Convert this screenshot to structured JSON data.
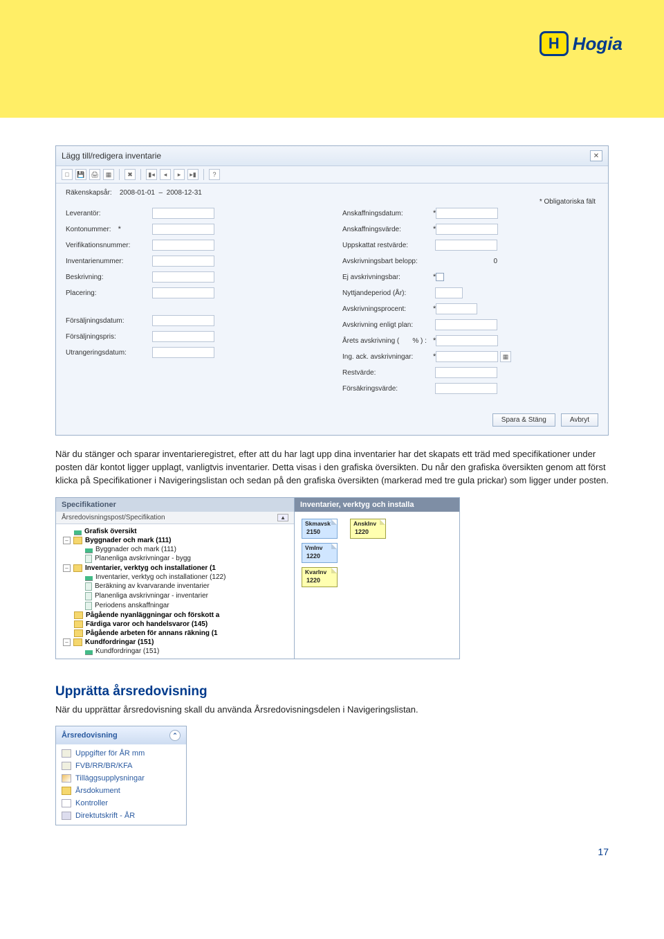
{
  "logo": {
    "badge": "H",
    "text": "Hogia"
  },
  "window": {
    "title": "Lägg till/redigera inventarie",
    "rakenskapsar_label": "Räkenskapsår:",
    "rakenskapsar_from": "2008-01-01",
    "rakenskapsar_sep": "–",
    "rakenskapsar_to": "2008-12-31",
    "mandatory_note": "* Obligatoriska fält",
    "left_fields": {
      "leverantor": "Leverantör:",
      "kontonummer": "Kontonummer:",
      "verifikationsnummer": "Verifikationsnummer:",
      "inventarienummer": "Inventarienummer:",
      "beskrivning": "Beskrivning:",
      "placering": "Placering:",
      "forsaljningsdatum": "Försäljningsdatum:",
      "forsaljningspris": "Försäljningspris:",
      "utrangeringsdatum": "Utrangeringsdatum:"
    },
    "right_fields": {
      "anskaffningsdatum": "Anskaffningsdatum:",
      "anskaffningsvarde": "Anskaffningsvärde:",
      "uppskattat_restvarde": "Uppskattat restvärde:",
      "avskrivningsbart_belopp": "Avskrivningsbart belopp:",
      "avskrivningsbart_value": "0",
      "ej_avskrivningsbar": "Ej avskrivningsbar:",
      "nyttjandeperiod": "Nyttjandeperiod (År):",
      "avskrivningsprocent": "Avskrivningsprocent:",
      "avskrivning_plan": "Avskrivning enligt plan:",
      "arets_avskrivning": "Årets avskrivning (",
      "arets_avskrivning_suffix": "% ) :",
      "ing_ack": "Ing. ack. avskrivningar:",
      "restvarde": "Restvärde:",
      "forsakringsvarde": "Försäkringsvärde:"
    },
    "buttons": {
      "save": "Spara & Stäng",
      "cancel": "Avbryt"
    }
  },
  "paragraph1": "När du stänger och sparar inventarieregistret, efter att du har lagt upp dina inventarier har det skapats ett träd med specifikationer under posten där kontot ligger upplagt, vanligtvis inventarier. Detta visas i den grafiska översikten. Du når den grafiska översikten genom att först klicka på Specifikationer i Navigeringslistan och sedan på den grafiska översikten (markerad med tre gula prickar) som ligger under posten.",
  "spec_panel": {
    "left_title": "Specifikationer",
    "right_title": "Inventarier, verktyg och installa",
    "subheader": "Årsredovisningspost/Specifikation",
    "tree": [
      {
        "indent": 1,
        "icon": "bar",
        "label": "Grafisk översikt",
        "bold": true
      },
      {
        "indent": 0,
        "icon": "exp-",
        "folder": true,
        "label": "Byggnader och mark (111)",
        "bold": true
      },
      {
        "indent": 2,
        "icon": "bar",
        "label": "Byggnader och mark (111)"
      },
      {
        "indent": 2,
        "icon": "page",
        "label": "Planenliga avskrivningar - bygg"
      },
      {
        "indent": 0,
        "icon": "exp-",
        "folder": true,
        "label": "Inventarier, verktyg och installationer (1",
        "bold": true
      },
      {
        "indent": 2,
        "icon": "bar",
        "label": "Inventarier, verktyg och installationer (122)"
      },
      {
        "indent": 2,
        "icon": "page",
        "label": "Beräkning av kvarvarande inventarier"
      },
      {
        "indent": 2,
        "icon": "page",
        "label": "Planenliga avskrivningar - inventarier"
      },
      {
        "indent": 2,
        "icon": "page",
        "label": "Periodens anskaffningar"
      },
      {
        "indent": 1,
        "folder": true,
        "label": "Pågående nyanläggningar och förskott a",
        "bold": true
      },
      {
        "indent": 1,
        "folder": true,
        "label": "Färdiga varor och handelsvaror (145)",
        "bold": true
      },
      {
        "indent": 1,
        "folder": true,
        "label": "Pågående arbeten för annans räkning (1",
        "bold": true
      },
      {
        "indent": 0,
        "icon": "exp-",
        "folder": true,
        "label": "Kundfordringar (151)",
        "bold": true
      },
      {
        "indent": 2,
        "icon": "bar",
        "label": "Kundfordringar (151)"
      }
    ],
    "notes": [
      [
        {
          "color": "blue",
          "title": "Skmavsk",
          "value": "2150"
        },
        {
          "color": "yellow",
          "title": "AnskInv",
          "value": "1220"
        }
      ],
      [
        {
          "color": "blue",
          "title": "VmInv",
          "value": "1220"
        }
      ],
      [
        {
          "color": "yellow",
          "title": "KvarInv",
          "value": "1220"
        }
      ]
    ]
  },
  "section2": {
    "heading": "Upprätta årsredovisning",
    "text": "När du upprättar årsredovisning skall du använda Årsredovisningsdelen i Navigeringslistan."
  },
  "nav": {
    "title": "Årsredovisning",
    "items": [
      {
        "icon": "form",
        "label": "Uppgifter för ÅR mm"
      },
      {
        "icon": "form",
        "label": "FVB/RR/BR/KFA"
      },
      {
        "icon": "pencil",
        "label": "Tilläggsupplysningar"
      },
      {
        "icon": "fold",
        "label": "Årsdokument"
      },
      {
        "icon": "check",
        "label": "Kontroller"
      },
      {
        "icon": "print",
        "label": "Direktutskrift - ÅR"
      }
    ]
  },
  "page_number": "17"
}
